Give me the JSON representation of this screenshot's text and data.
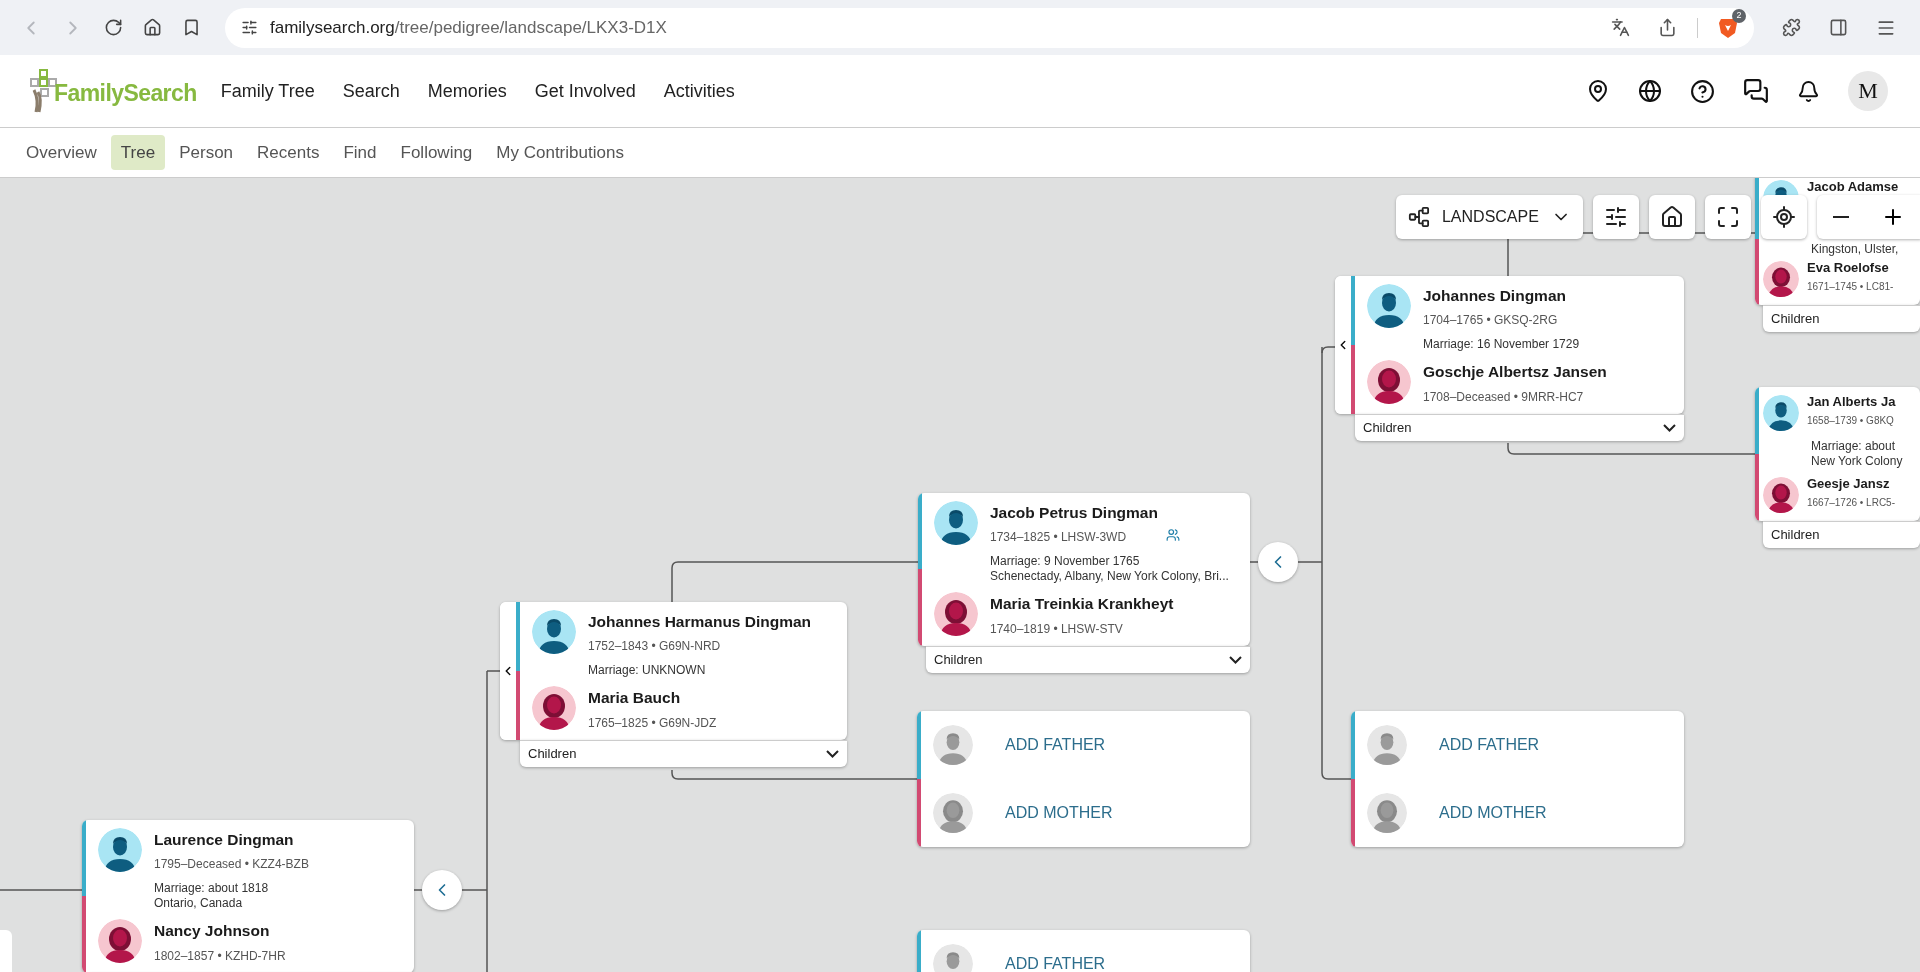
{
  "browser": {
    "url_host": "familysearch.org",
    "url_path": "/tree/pedigree/landscape/LKX3-D1X",
    "shield_badge": "2"
  },
  "header": {
    "logo_text": "FamilySearch",
    "nav": [
      "Family Tree",
      "Search",
      "Memories",
      "Get Involved",
      "Activities"
    ],
    "avatar_initial": "M"
  },
  "subnav": [
    {
      "label": "Overview",
      "selected": false
    },
    {
      "label": "Tree",
      "selected": true
    },
    {
      "label": "Person",
      "selected": false
    },
    {
      "label": "Recents",
      "selected": false
    },
    {
      "label": "Find",
      "selected": false
    },
    {
      "label": "Following",
      "selected": false
    },
    {
      "label": "My Contributions",
      "selected": false
    }
  ],
  "toolbar": {
    "view_label": "LANDSCAPE"
  },
  "couples": [
    {
      "kind": "couple",
      "husband": {
        "name": "Johannes Dingman",
        "info": "1704–1765 • GKSQ-2RG"
      },
      "marriage": [
        "Marriage: 16 November 1729"
      ],
      "wife": {
        "name": "Goschje Albertsz Jansen",
        "info": "1708–Deceased • 9MRR-HC7"
      },
      "children_label": "Children",
      "linked": false
    },
    {
      "kind": "couple",
      "husband": {
        "name": "Jacob Petrus Dingman",
        "info": "1734–1825 • LHSW-3WD"
      },
      "marriage": [
        "Marriage: 9 November 1765",
        "Schenectady, Albany, New York Colony, Bri..."
      ],
      "wife": {
        "name": "Maria Treinkia Krankheyt",
        "info": "1740–1819 • LHSW-STV"
      },
      "children_label": "Children",
      "linked": true
    },
    {
      "kind": "couple",
      "husband": {
        "name": "Johannes Harmanus Dingman",
        "info": "1752–1843 • G69N-NRD"
      },
      "marriage": [
        "Marriage: UNKNOWN"
      ],
      "wife": {
        "name": "Maria Bauch",
        "info": "1765–1825 • G69N-JDZ"
      },
      "children_label": "Children",
      "linked": false
    },
    {
      "kind": "couple",
      "husband": {
        "name": "Laurence Dingman",
        "info": "1795–Deceased • KZZ4-BZB"
      },
      "marriage": [
        "Marriage: about 1818",
        "Ontario, Canada"
      ],
      "wife": {
        "name": "Nancy Johnson",
        "info": "1802–1857 • KZHD-7HR"
      },
      "linked": false
    },
    {
      "kind": "couple",
      "husband": {
        "name": "Jacob Adamse"
      },
      "marriage": [
        "Kingston, Ulster,"
      ],
      "wife": {
        "name": "Eva Roelofse",
        "info": "1671–1745 • LC81-"
      },
      "children_label": "Children",
      "linked": false
    },
    {
      "kind": "couple",
      "husband": {
        "name": "Jan Alberts Ja",
        "info": "1658–1739 • G8KQ"
      },
      "marriage": [
        "Marriage: about",
        "New York Colony"
      ],
      "wife": {
        "name": "Geesje Jansz",
        "info": "1667–1726 • LRC5-"
      },
      "children_label": "Children",
      "linked": false
    },
    {
      "kind": "add",
      "father_label": "ADD FATHER",
      "mother_label": "ADD MOTHER"
    },
    {
      "kind": "add",
      "father_label": "ADD FATHER",
      "mother_label": "ADD MOTHER"
    },
    {
      "kind": "add",
      "father_label": "ADD FATHER"
    }
  ]
}
